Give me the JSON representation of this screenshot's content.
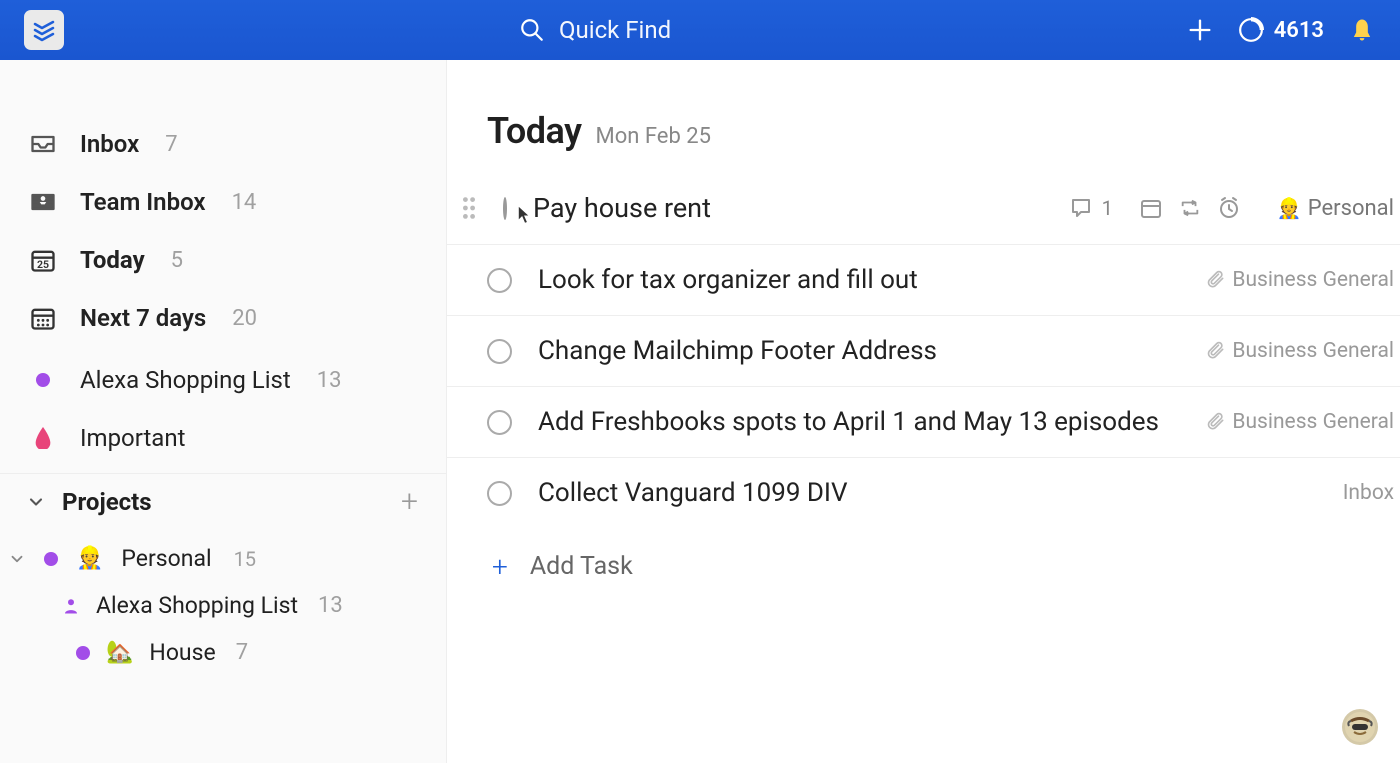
{
  "header": {
    "search_placeholder": "Quick Find",
    "karma_points": "4613"
  },
  "sidebar": {
    "nav": [
      {
        "label": "Inbox",
        "count": "7"
      },
      {
        "label": "Team Inbox",
        "count": "14"
      },
      {
        "label": "Today",
        "count": "5"
      },
      {
        "label": "Next 7 days",
        "count": "20"
      }
    ],
    "favorites": [
      {
        "label": "Alexa Shopping List",
        "count": "13"
      },
      {
        "label": "Important"
      }
    ],
    "projects_label": "Projects",
    "projects": [
      {
        "label": "Personal",
        "count": "15"
      }
    ],
    "subprojects": [
      {
        "label": "Alexa Shopping List",
        "count": "13"
      },
      {
        "label": "House",
        "count": "7"
      }
    ]
  },
  "main": {
    "title": "Today",
    "date": "Mon Feb 25",
    "tasks": [
      {
        "text": "Pay house rent",
        "comments": "1",
        "tag": "Personal",
        "tag_type": "personal",
        "hovered": true
      },
      {
        "text": "Look for tax organizer and fill out",
        "tag": "Business General",
        "tag_type": "business"
      },
      {
        "text": "Change Mailchimp Footer Address",
        "tag": "Business General",
        "tag_type": "business"
      },
      {
        "text": "Add Freshbooks spots to April 1 and May 13 episodes",
        "tag": "Business General",
        "tag_type": "business"
      },
      {
        "text": "Collect Vanguard 1099 DIV",
        "tag": "Inbox",
        "tag_type": "inbox"
      }
    ],
    "add_task_label": "Add Task"
  }
}
